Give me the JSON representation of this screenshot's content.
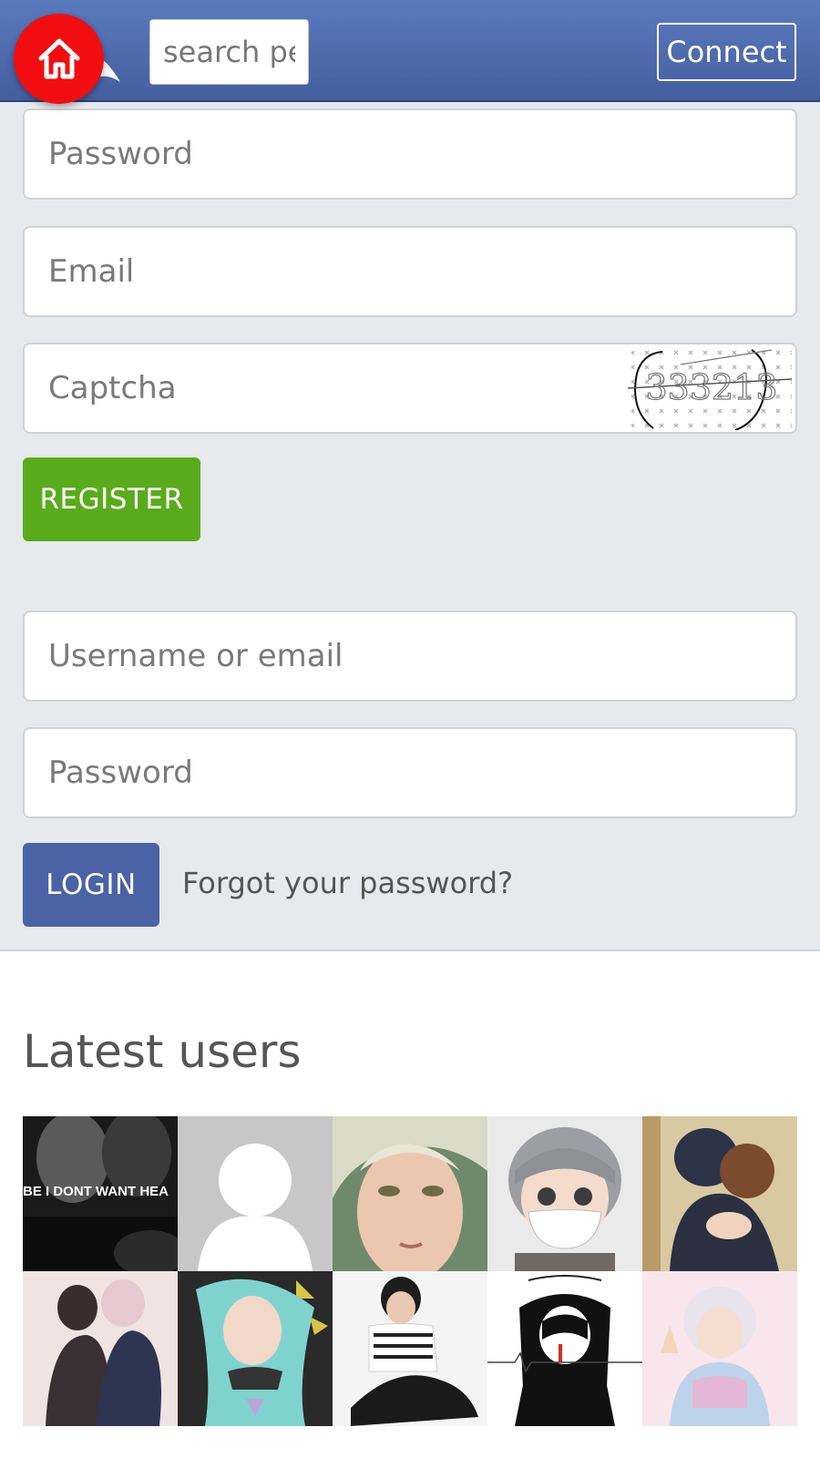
{
  "header": {
    "search_placeholder": "search pe",
    "connect_label": "Connect",
    "home_icon": "home-icon",
    "colors": {
      "bar": "#4a66a8",
      "home": "#f20d10"
    }
  },
  "register": {
    "password_placeholder": "Password",
    "email_placeholder": "Email",
    "captcha_placeholder": "Captcha",
    "captcha_text": "333213",
    "button_label": "REGISTER",
    "button_color": "#5aab1c"
  },
  "login": {
    "username_placeholder": "Username or email",
    "password_placeholder": "Password",
    "button_label": "LOGIN",
    "button_color": "#4a62a6",
    "forgot_label": "Forgot your password?"
  },
  "latest_users": {
    "title": "Latest users",
    "thumb_1_caption": "BE I DONT WANT HEA"
  }
}
